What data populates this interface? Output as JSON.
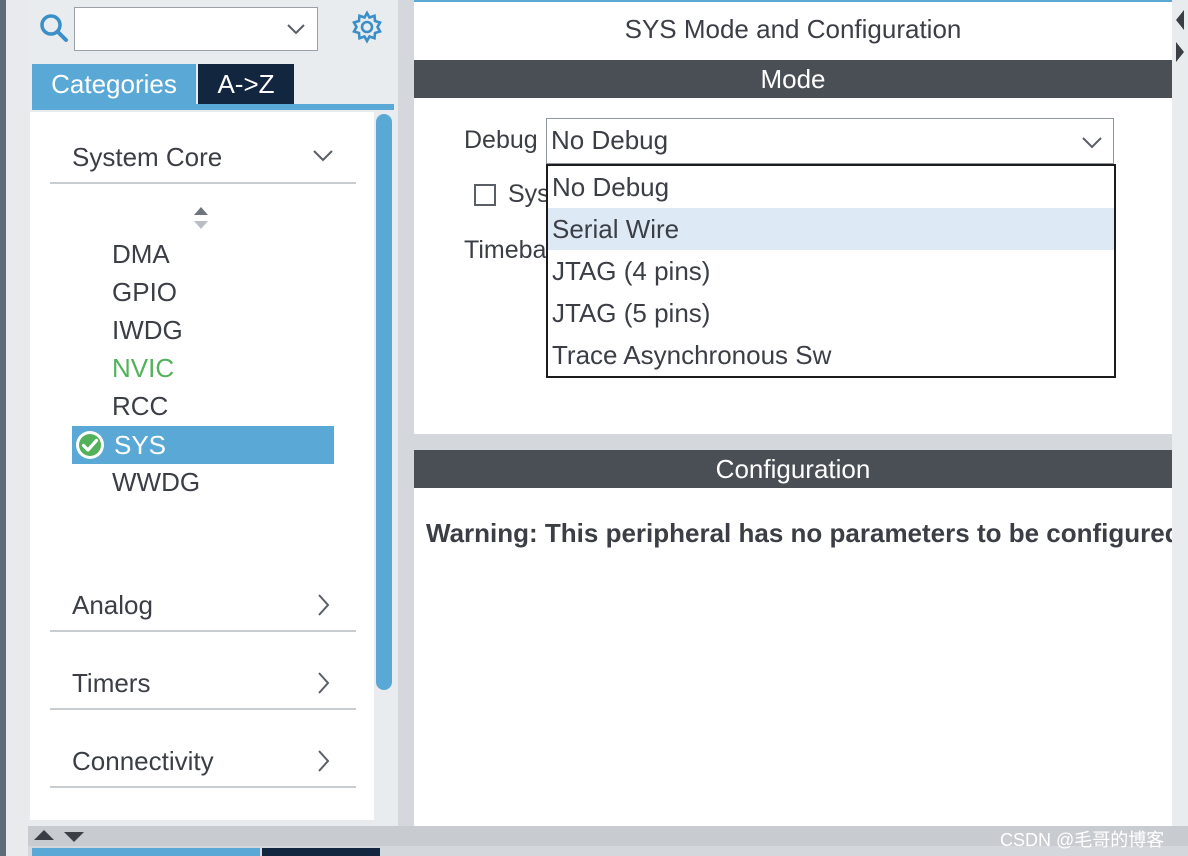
{
  "left_panel": {
    "search": {
      "value": "",
      "placeholder": ""
    },
    "tabs": [
      {
        "label": "Categories",
        "active": true
      },
      {
        "label": "A->Z",
        "active": false
      }
    ],
    "categories": [
      {
        "label": "System Core",
        "expanded": true
      },
      {
        "label": "Analog",
        "expanded": false
      },
      {
        "label": "Timers",
        "expanded": false
      },
      {
        "label": "Connectivity",
        "expanded": false
      }
    ],
    "system_core_items": [
      "DMA",
      "GPIO",
      "IWDG",
      "NVIC",
      "RCC",
      "SYS",
      "WWDG"
    ],
    "selected_item": "SYS"
  },
  "right_panel": {
    "title": "SYS Mode and Configuration",
    "mode_header": "Mode",
    "debug_label": "Debug",
    "debug_value": "No Debug",
    "sys_checkbox_label": "Sys",
    "timebase_label": "Timeba",
    "debug_options": [
      "No Debug",
      "Serial Wire",
      "JTAG (4 pins)",
      "JTAG (5 pins)",
      "Trace Asynchronous Sw"
    ],
    "highlighted_option": "Serial Wire",
    "configuration_header": "Configuration",
    "warning": "Warning: This peripheral has no parameters to be configured"
  },
  "watermark": "CSDN @毛哥的博客",
  "colors": {
    "accent_blue": "#5aa8d6",
    "dark_navy": "#13263f",
    "header_gray": "#4a4f55",
    "nvic_green": "#53b15a",
    "highlight": "#dde9f5"
  }
}
